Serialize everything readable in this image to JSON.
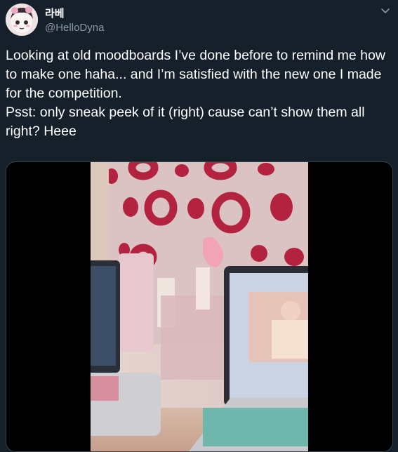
{
  "tweet": {
    "display_name": "라베",
    "handle": "@HelloDyna",
    "text": "Looking at old moodboards I’ve done before to remind me how to make one haha... and I’m satisfied with the new one I made for the competition.\nPsst: only sneak peek of it (right) cause can’t show them all right? Heee"
  },
  "icons": {
    "caret": "chevron-down-icon",
    "avatar": "profile-avatar"
  },
  "colors": {
    "background": "#15202b",
    "secondary_text": "#8899a6",
    "border": "#38444d"
  }
}
